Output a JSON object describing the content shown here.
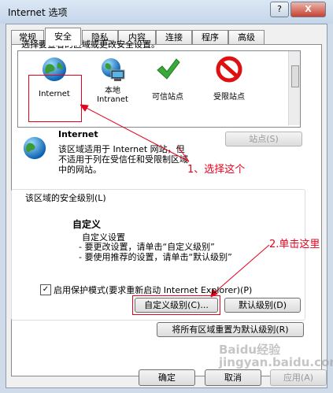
{
  "window": {
    "title": "Internet 选项",
    "help_label": "?",
    "close_label": "X"
  },
  "tabs": [
    {
      "label": "常规"
    },
    {
      "label": "安全"
    },
    {
      "label": "隐私"
    },
    {
      "label": "内容"
    },
    {
      "label": "连接"
    },
    {
      "label": "程序"
    },
    {
      "label": "高级"
    }
  ],
  "security": {
    "instruction": "选择要查看的区域或更改安全设置。",
    "zones": [
      {
        "label": "Internet",
        "icon": "globe-icon"
      },
      {
        "label": "本地\nIntranet",
        "icon": "local-intranet-icon"
      },
      {
        "label": "可信站点",
        "icon": "checkmark-icon"
      },
      {
        "label": "受限站点",
        "icon": "restricted-icon"
      }
    ],
    "selected_zone": {
      "title": "Internet",
      "description": "该区域适用于 Internet 网站，但\n不适用于列在受信任和受限制区域\n中的网站。"
    },
    "sites_button": "站点(S)",
    "level_group_label": "该区域的安全级别(L)",
    "custom": {
      "title": "自定义",
      "lines": [
        "自定义设置",
        "- 要更改设置，请单击“自定义级别”",
        "- 要使用推荐的设置，请单击“默认级别”"
      ]
    },
    "protected_mode": {
      "label": "启用保护模式(要求重新启动 Internet Explorer)(P)",
      "checked": true
    },
    "custom_level_button": "自定义级别(C)...",
    "default_level_button": "默认级别(D)",
    "reset_all_button": "将所有区域重置为默认级别(R)"
  },
  "annotations": {
    "step1": "1、选择这个",
    "step2": "2.单击这里"
  },
  "footer": {
    "ok": "确定",
    "cancel": "取消",
    "apply": "应用(A)"
  },
  "watermark": "Baidu经验\njingyan.baidu.com",
  "colors": {
    "annotation_red": "#e8001c",
    "title_bg": "#cfdbe9"
  }
}
